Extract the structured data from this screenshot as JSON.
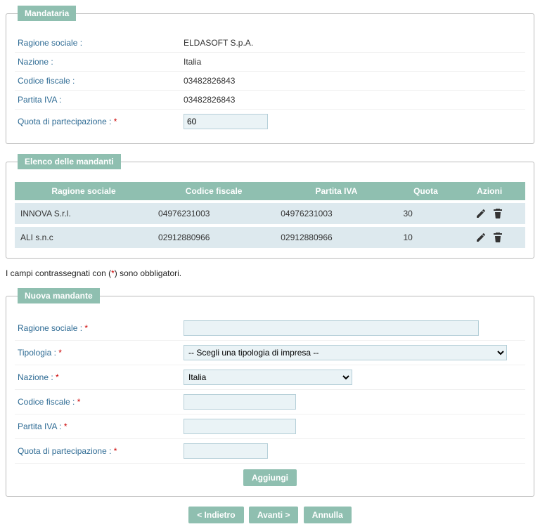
{
  "mandataria": {
    "legend": "Mandataria",
    "labels": {
      "ragione": "Ragione sociale :",
      "nazione": "Nazione :",
      "codfisc": "Codice fiscale :",
      "piva": "Partita IVA :",
      "quota": "Quota di partecipazione : "
    },
    "values": {
      "ragione": "ELDASOFT S.p.A.",
      "nazione": "Italia",
      "codfisc": "03482826843",
      "piva": "03482826843",
      "quota": "60"
    }
  },
  "mandanti": {
    "legend": "Elenco delle mandanti",
    "headers": {
      "ragione": "Ragione sociale",
      "codfisc": "Codice fiscale",
      "piva": "Partita IVA",
      "quota": "Quota",
      "azioni": "Azioni"
    },
    "rows": [
      {
        "ragione": "INNOVA S.r.l.",
        "codfisc": "04976231003",
        "piva": "04976231003",
        "quota": "30"
      },
      {
        "ragione": "ALI s.n.c",
        "codfisc": "02912880966",
        "piva": "02912880966",
        "quota": "10"
      }
    ]
  },
  "note": {
    "pre": "I campi contrassegnati con (",
    "mark": "*",
    "post": ") sono obbligatori."
  },
  "nuova": {
    "legend": "Nuova mandante",
    "labels": {
      "ragione": "Ragione sociale : ",
      "tipologia": "Tipologia : ",
      "nazione": "Nazione : ",
      "codfisc": "Codice fiscale : ",
      "piva": "Partita IVA : ",
      "quota": "Quota di partecipazione : "
    },
    "values": {
      "ragione": "",
      "tipologia_selected": "-- Scegli una tipologia di impresa --",
      "nazione_selected": "Italia",
      "codfisc": "",
      "piva": "",
      "quota": ""
    },
    "add_label": "Aggiungi"
  },
  "nav": {
    "back": "< Indietro",
    "next": "Avanti >",
    "cancel": "Annulla"
  },
  "req_mark": "*"
}
